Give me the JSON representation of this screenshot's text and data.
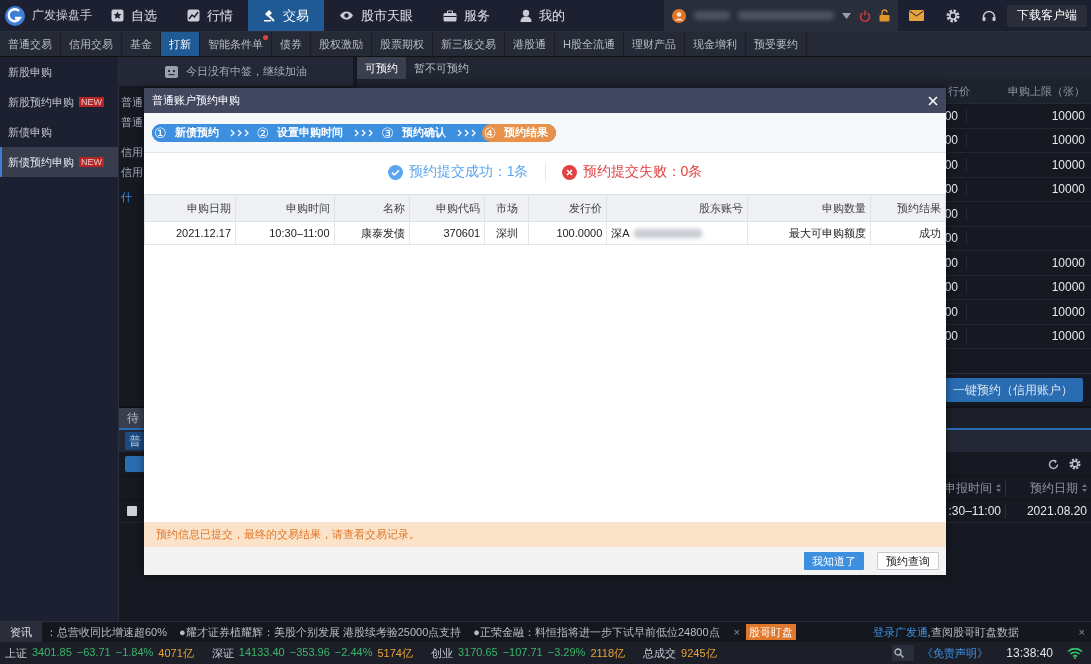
{
  "app": {
    "name": "广发操盘手"
  },
  "nav": [
    {
      "label": "自选",
      "selected": false
    },
    {
      "label": "行情",
      "selected": false
    },
    {
      "label": "交易",
      "selected": true
    },
    {
      "label": "股市天眼",
      "selected": false
    },
    {
      "label": "服务",
      "selected": false
    },
    {
      "label": "我的",
      "selected": false
    }
  ],
  "account": {
    "download_button": "下载客户端"
  },
  "trade_tabs": [
    {
      "label": "普通交易",
      "selected": false,
      "dot": false
    },
    {
      "label": "信用交易",
      "selected": false,
      "dot": false
    },
    {
      "label": "基金",
      "selected": false,
      "dot": false
    },
    {
      "label": "打新",
      "selected": true,
      "dot": false
    },
    {
      "label": "智能条件单",
      "selected": false,
      "dot": true
    },
    {
      "label": "债券",
      "selected": false,
      "dot": false
    },
    {
      "label": "股权激励",
      "selected": false,
      "dot": false
    },
    {
      "label": "股票期权",
      "selected": false,
      "dot": false
    },
    {
      "label": "新三板交易",
      "selected": false,
      "dot": false
    },
    {
      "label": "港股通",
      "selected": false,
      "dot": false
    },
    {
      "label": "H股全流通",
      "selected": false,
      "dot": false
    },
    {
      "label": "理财产品",
      "selected": false,
      "dot": false
    },
    {
      "label": "现金增利",
      "selected": false,
      "dot": false
    },
    {
      "label": "预受要约",
      "selected": false,
      "dot": false
    }
  ],
  "sidebar": [
    {
      "label": "新股申购",
      "selected": false
    },
    {
      "label": "新股预约申购",
      "badge": "NEW",
      "selected": false
    },
    {
      "label": "新债申购",
      "selected": false
    },
    {
      "label": "新债预约申购",
      "badge": "NEW",
      "selected": true
    }
  ],
  "left_panel": {
    "banner": "今日没有中签，继续加油",
    "lines": [
      "普通",
      "普通",
      "信用",
      "信用"
    ],
    "link": "什"
  },
  "list_tabs": [
    {
      "label": "可预约",
      "selected": true
    },
    {
      "label": "暂不可预约",
      "selected": false
    }
  ],
  "bond_table": {
    "columns": [
      "行价",
      "申购上限（张）"
    ],
    "rows": [
      {
        "price": "00",
        "limit": "10000"
      },
      {
        "price": "00",
        "limit": "10000"
      },
      {
        "price": "00",
        "limit": "10000"
      },
      {
        "price": "00",
        "limit": "10000"
      },
      {
        "price": "00"
      },
      {
        "price": "00"
      },
      {
        "price": "00",
        "limit": "10000"
      },
      {
        "price": "00",
        "limit": "10000"
      },
      {
        "price": "00",
        "limit": "10000"
      },
      {
        "price": "00",
        "limit": "10000"
      }
    ]
  },
  "action_button": "一键预约（信用账户）",
  "bottom_panel": {
    "tab": "待",
    "account_button": "普",
    "columns": [
      "申报时间",
      "预约日期"
    ],
    "rows": [
      {
        "checked": false,
        "cells": [
          ":30–11:00",
          "2021.08.20"
        ]
      }
    ]
  },
  "dialog": {
    "title": "普通账户预约申购",
    "steps": [
      {
        "num": "①",
        "label": "新债预约",
        "current": false
      },
      {
        "num": "②",
        "label": "设置申购时间",
        "current": false
      },
      {
        "num": "③",
        "label": "预约确认",
        "current": false
      },
      {
        "num": "④",
        "label": "预约结果",
        "current": true
      }
    ],
    "results": [
      {
        "kind": "success",
        "text": "预约提交成功：1条"
      },
      {
        "kind": "failure",
        "text": "预约提交失败：0条"
      }
    ],
    "columns": [
      "申购日期",
      "申购时间",
      "名称",
      "申购代码",
      "市场",
      "发行价",
      "股东账号",
      "申购数量",
      "预约结果"
    ],
    "rows": [
      [
        "2021.12.17",
        "10:30–11:00",
        "康泰发债",
        "370601",
        "深圳",
        "100.0000",
        "深A",
        "最大可申购额度",
        "成功"
      ]
    ],
    "notice": "预约信息已提交，最终的交易结果，请查看交易记录。",
    "buttons": [
      {
        "label": "我知道了",
        "kind": "primary"
      },
      {
        "label": "预约查询",
        "kind": "secondary"
      }
    ]
  },
  "news": {
    "label": "资讯",
    "items": [
      "：总营收同比增速超60%",
      "●耀才证券植耀辉：美股个别发展 港股续考验25000点支持",
      "●正荣金融：料恒指将进一步下试早前低位24800点"
    ],
    "close": "×",
    "tag": "股哥盯盘",
    "link": "登录广发通",
    "link_text": ",查阅股哥盯盘数据",
    "close2": "×"
  },
  "indices": [
    {
      "name": "上证",
      "price": "3401.85",
      "change": "−63.71",
      "percent": "−1.84%",
      "volume": "4071亿"
    },
    {
      "name": "深证",
      "price": "14133.40",
      "change": "−353.96",
      "percent": "−2.44%",
      "volume": "5174亿"
    },
    {
      "name": "创业",
      "price": "3170.65",
      "change": "−107.71",
      "percent": "−3.29%",
      "volume": "2118亿"
    }
  ],
  "total": {
    "label": "总成交",
    "value": "9245亿"
  },
  "disclaimer": "《免责声明》",
  "clock": "13:38:40"
}
